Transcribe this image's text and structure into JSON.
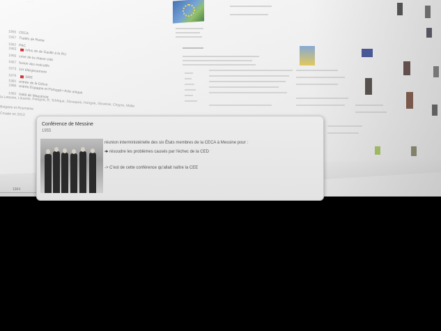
{
  "timeline": {
    "items": [
      {
        "year": "1955",
        "text": "CECA"
      },
      {
        "year": "1957",
        "text": "Traités de Rome"
      },
      {
        "year": "1962",
        "text": "PAC"
      },
      {
        "year": "1963",
        "text": "refus de de Gaulle à la RU"
      },
      {
        "year": "1965",
        "text": "crise de la chaise vide"
      },
      {
        "year": "1967",
        "text": "fusion des exécutifs"
      },
      {
        "year": "1973",
        "text": "1er élargissement"
      },
      {
        "year": "1979",
        "text": "SME"
      },
      {
        "year": "1981",
        "text": "entrée de la Grèce"
      },
      {
        "year": "1986",
        "text": "entrée Espagne et Portugal • Acte unique"
      },
      {
        "year": "1992",
        "text": "traité de Maastricht"
      }
    ],
    "extra_lines": [
      "la Lettonie, Lituanie, Pologne, R. Tchèque, Slovaquie, Hongrie, Slovénie, Chypre, Malte",
      "Bulgarie et Roumanie",
      "Croatie en 2013"
    ],
    "axis_year": "1964"
  },
  "callout": {
    "title": "Conférence de Messine",
    "year": "1955",
    "line1": "réunion interministérielle des six États membres de la CECA à Messine pour :",
    "line2_arrow": "➔",
    "line2": "résoudre les problèmes causés par l'échec de la CED",
    "line3": "-> C'est de cette conférence qu'allait naître la CEE"
  },
  "colors": {
    "background": "#000000",
    "wall": "#f4f4f4",
    "callout": "#e6e6e6",
    "flag": "#cc3333"
  }
}
